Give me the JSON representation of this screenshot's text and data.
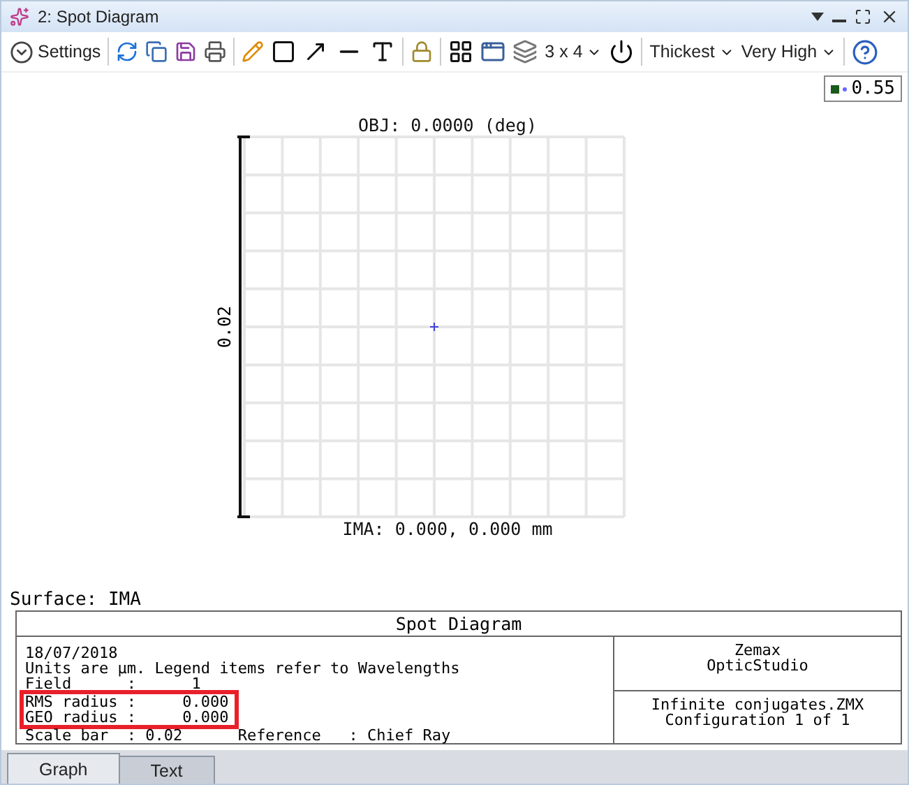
{
  "window": {
    "title": "2: Spot Diagram"
  },
  "toolbar": {
    "settings": "Settings",
    "layout": "3 x 4",
    "thickness": "Thickest",
    "resolution": "Very High"
  },
  "legend": {
    "value": "0.55"
  },
  "plot": {
    "title": "OBJ: 0.0000 (deg)",
    "scale_label": "0.02",
    "footer": "IMA: 0.000, 0.000 mm"
  },
  "surface": "Surface: IMA",
  "report": {
    "title": "Spot Diagram",
    "lines": [
      {
        "text": "18/07/2018",
        "highlighted": false
      },
      {
        "text": "Units are µm. Legend items refer to Wavelengths",
        "highlighted": false
      },
      {
        "text": "Field      :      1",
        "highlighted": false
      },
      {
        "text": "RMS radius :     0.000",
        "highlighted": true
      },
      {
        "text": "GEO radius :     0.000",
        "highlighted": true
      },
      {
        "text": "Scale bar  : 0.02      Reference   : Chief Ray",
        "highlighted": false
      }
    ],
    "brand": [
      "Zemax",
      "OpticStudio"
    ],
    "file": [
      "Infinite conjugates.ZMX",
      "Configuration 1 of 1"
    ]
  },
  "tabs": [
    {
      "label": "Graph",
      "selected": true
    },
    {
      "label": "Text",
      "selected": false
    }
  ]
}
